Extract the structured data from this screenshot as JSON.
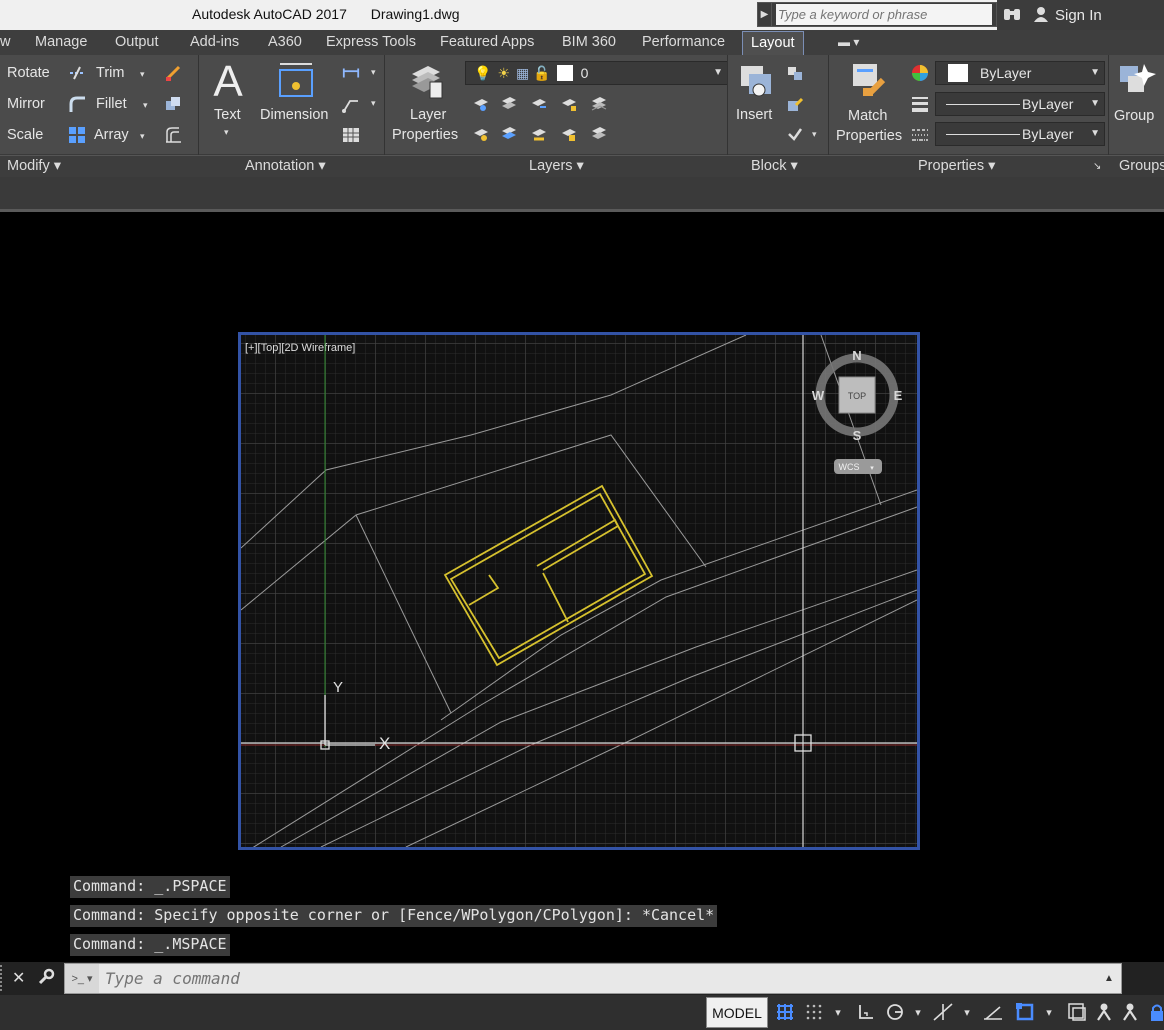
{
  "titlebar": {
    "app": "Autodesk AutoCAD 2017",
    "file": "Drawing1.dwg",
    "search_placeholder": "Type a keyword or phrase",
    "signin": "Sign In"
  },
  "tabs": [
    "w",
    "Manage",
    "Output",
    "Add-ins",
    "A360",
    "Express Tools",
    "Featured Apps",
    "BIM 360",
    "Performance",
    "Layout"
  ],
  "modify": {
    "rotate": "Rotate",
    "trim": "Trim",
    "mirror": "Mirror",
    "fillet": "Fillet",
    "scale": "Scale",
    "array": "Array",
    "title": "Modify"
  },
  "annotation": {
    "text": "Text",
    "dimension": "Dimension",
    "title": "Annotation"
  },
  "layers": {
    "layer_properties_1": "Layer",
    "layer_properties_2": "Properties",
    "current_layer": "0",
    "title": "Layers"
  },
  "block": {
    "insert": "Insert",
    "title": "Block"
  },
  "properties": {
    "match_1": "Match",
    "match_2": "Properties",
    "color": "ByLayer",
    "linetype": "ByLayer",
    "lineweight": "ByLayer",
    "title": "Properties"
  },
  "groups": {
    "group": "Group",
    "title": "Groups"
  },
  "viewport": {
    "label": "[+][Top][2D Wireframe]",
    "compass": {
      "n": "N",
      "s": "S",
      "e": "E",
      "w": "W",
      "top": "TOP",
      "wcs": "WCS"
    },
    "ucs": {
      "x": "X",
      "y": "Y"
    }
  },
  "command_history": [
    "Command:  _.PSPACE",
    "Command: Specify opposite corner or [Fence/WPolygon/CPolygon]: *Cancel*",
    "Command:  _.MSPACE"
  ],
  "command_placeholder": "Type a command",
  "status": {
    "model": "MODEL"
  },
  "colors": {
    "accent": "#3353a6",
    "building": "#d6c12e",
    "grid": "#464646"
  }
}
